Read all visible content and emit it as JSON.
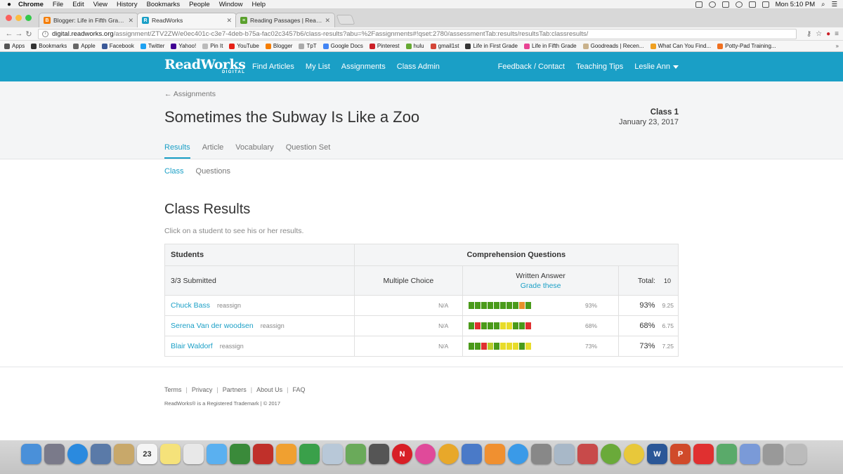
{
  "mac_menubar": {
    "app": "Chrome",
    "menus": [
      "File",
      "Edit",
      "View",
      "History",
      "Bookmarks",
      "People",
      "Window",
      "Help"
    ],
    "clock": "Mon 5:10 PM"
  },
  "browser": {
    "tabs": [
      {
        "title": "Blogger: Life in Fifth Grade -",
        "favicon_color": "#f57d00",
        "favicon_letter": "B"
      },
      {
        "title": "ReadWorks",
        "favicon_color": "#1a9fc6",
        "favicon_letter": "R"
      },
      {
        "title": "Reading Passages | ReadWork",
        "favicon_color": "#5aa02c",
        "favicon_letter": "≡"
      }
    ],
    "url_host": "digital.readworks.org",
    "url_path": "/assignment/ZTV2ZW/e0ec401c-c3e7-4deb-b75a-fac02c3457b6/class-results?abu=%2Fassignments#!qset:2780/assessmentTab:results/resultsTab:classresults/",
    "bookmarks": [
      {
        "label": "Apps",
        "color": "#555555"
      },
      {
        "label": "Bookmarks",
        "color": "#333333"
      },
      {
        "label": "Apple",
        "color": "#666666"
      },
      {
        "label": "Facebook",
        "color": "#3b5998"
      },
      {
        "label": "Twitter",
        "color": "#1da1f2"
      },
      {
        "label": "Yahoo!",
        "color": "#410093"
      },
      {
        "label": "Pin It",
        "color": "#bbbbbb"
      },
      {
        "label": "YouTube",
        "color": "#e62117"
      },
      {
        "label": "Blogger",
        "color": "#f57d00"
      },
      {
        "label": "TpT",
        "color": "#aaaaaa"
      },
      {
        "label": "Google Docs",
        "color": "#4285f4"
      },
      {
        "label": "Pinterest",
        "color": "#cb2027"
      },
      {
        "label": "hulu",
        "color": "#66aa33"
      },
      {
        "label": "gmail1st",
        "color": "#d44638"
      },
      {
        "label": "Life in First Grade",
        "color": "#333333"
      },
      {
        "label": "Life in Fifth Grade",
        "color": "#e84393"
      },
      {
        "label": "Goodreads | Recen...",
        "color": "#c9b28c"
      },
      {
        "label": "What Can You Find...",
        "color": "#f0a020"
      },
      {
        "label": "Potty-Pad Training...",
        "color": "#f07020"
      }
    ]
  },
  "header": {
    "logo_main": "ReadWorks",
    "logo_sub": "DIGITAL",
    "nav_left": [
      "Find Articles",
      "My List",
      "Assignments",
      "Class Admin"
    ],
    "nav_right": [
      "Feedback / Contact",
      "Teaching Tips"
    ],
    "user": "Leslie Ann"
  },
  "page": {
    "back_link": "← Assignments",
    "title": "Sometimes the Subway Is Like a Zoo",
    "class_name": "Class 1",
    "date": "January 23, 2017",
    "tabs": [
      "Results",
      "Article",
      "Vocabulary",
      "Question Set"
    ],
    "subtabs": [
      "Class",
      "Questions"
    ],
    "section_title": "Class Results",
    "section_subtitle": "Click on a student to see his or her results."
  },
  "table": {
    "students_header": "Students",
    "comprehension_header": "Comprehension Questions",
    "submitted": "3/3 Submitted",
    "mc_header": "Multiple Choice",
    "wa_header": "Written Answer",
    "grade_link": "Grade these",
    "total_label": "Total:",
    "total_points": "10",
    "reassign_label": "reassign",
    "rows": [
      {
        "name": "Chuck Bass",
        "mc": "N/A",
        "wa_pct": "93%",
        "total_pct": "93%",
        "score": "9.25",
        "blocks": [
          "#4a9a1a",
          "#4a9a1a",
          "#4a9a1a",
          "#4a9a1a",
          "#4a9a1a",
          "#4a9a1a",
          "#4a9a1a",
          "#4a9a1a",
          "#e8902a",
          "#4a9a1a"
        ]
      },
      {
        "name": "Serena Van der woodsen",
        "mc": "N/A",
        "wa_pct": "68%",
        "total_pct": "68%",
        "score": "6.75",
        "blocks": [
          "#4a9a1a",
          "#e03030",
          "#4a9a1a",
          "#4a9a1a",
          "#4a9a1a",
          "#e8dc2a",
          "#e8dc2a",
          "#4a9a1a",
          "#4a9a1a",
          "#e03030"
        ]
      },
      {
        "name": "Blair Waldorf",
        "mc": "N/A",
        "wa_pct": "73%",
        "total_pct": "73%",
        "score": "7.25",
        "blocks": [
          "#4a9a1a",
          "#4a9a1a",
          "#e03030",
          "#b8cc2a",
          "#4a9a1a",
          "#e8dc2a",
          "#e8dc2a",
          "#e8dc2a",
          "#4a9a1a",
          "#e8dc2a"
        ]
      }
    ]
  },
  "footer": {
    "links": [
      "Terms",
      "Privacy",
      "Partners",
      "About Us",
      "FAQ"
    ],
    "copyright": "ReadWorks® is a Registered Trademark | © 2017"
  },
  "dock": {
    "apps": [
      {
        "name": "finder",
        "color": "#4a90d9"
      },
      {
        "name": "launchpad",
        "color": "#7a7a8a"
      },
      {
        "name": "safari",
        "color": "#2a8adf"
      },
      {
        "name": "mail",
        "color": "#5a7aa8"
      },
      {
        "name": "contacts",
        "color": "#c8a86a"
      },
      {
        "name": "calendar",
        "color": "#f5f5f5",
        "label": "23"
      },
      {
        "name": "notes",
        "color": "#f5e27a"
      },
      {
        "name": "reminders",
        "color": "#e8e8e8"
      },
      {
        "name": "messages",
        "color": "#5ab0f0"
      },
      {
        "name": "facetime",
        "color": "#3a8a3a"
      },
      {
        "name": "photo-booth",
        "color": "#c0302a"
      },
      {
        "name": "pages",
        "color": "#f0a030"
      },
      {
        "name": "numbers",
        "color": "#3aa04a"
      },
      {
        "name": "keynote",
        "color": "#b8c8d8"
      },
      {
        "name": "iphoto",
        "color": "#6aaa5a"
      },
      {
        "name": "image-capture",
        "color": "#555555"
      },
      {
        "name": "netflix",
        "color": "#d81f26",
        "label": "N"
      },
      {
        "name": "itunes",
        "color": "#e04a9a"
      },
      {
        "name": "chrome",
        "color": "#e8a82a"
      },
      {
        "name": "keynote-2",
        "color": "#4a7ac8"
      },
      {
        "name": "ibooks",
        "color": "#f09030"
      },
      {
        "name": "app-store",
        "color": "#3a9ae8"
      },
      {
        "name": "system-preferences",
        "color": "#888888"
      },
      {
        "name": "preview",
        "color": "#a8b8c8"
      },
      {
        "name": "photos",
        "color": "#c84a4a"
      },
      {
        "name": "color-app",
        "color": "#6aaa3a"
      },
      {
        "name": "pinwheel",
        "color": "#e8c83a"
      },
      {
        "name": "word",
        "color": "#2b5797",
        "label": "W"
      },
      {
        "name": "powerpoint",
        "color": "#d04a2a",
        "label": "P"
      },
      {
        "name": "pdf",
        "color": "#e03030"
      },
      {
        "name": "downloads",
        "color": "#5aaa6a"
      },
      {
        "name": "folder",
        "color": "#7a9ad8"
      },
      {
        "name": "screen",
        "color": "#999999"
      },
      {
        "name": "trash",
        "color": "#bbbbbb"
      }
    ]
  }
}
